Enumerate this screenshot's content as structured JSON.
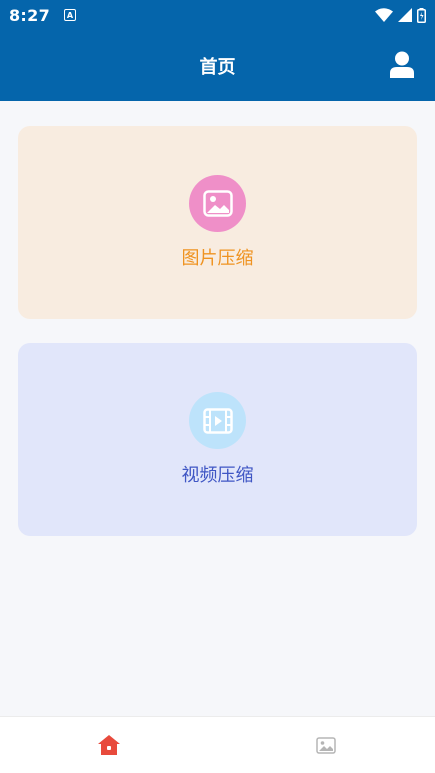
{
  "status_bar": {
    "time": "8:27",
    "notification_letter": "A",
    "icons": [
      "wifi-icon",
      "signal-icon",
      "battery-icon"
    ]
  },
  "app_bar": {
    "title": "首页",
    "profile_icon": "person-icon"
  },
  "cards": [
    {
      "label": "图片压缩",
      "icon": "image-icon",
      "accent": "#ef9321",
      "background": "#f8ece0",
      "icon_bg": "#ef8fc8"
    },
    {
      "label": "视频压缩",
      "icon": "video-icon",
      "accent": "#3f56c4",
      "background": "#e1e6fa",
      "icon_bg": "#bde3fb"
    }
  ],
  "bottom_nav": {
    "items": [
      {
        "icon": "home-icon",
        "active": true,
        "color": "#e84a3c"
      },
      {
        "icon": "image-icon",
        "active": false,
        "color": "#b5b5b5"
      }
    ]
  },
  "colors": {
    "primary": "#0565ab",
    "page_bg": "#f6f7fa"
  }
}
